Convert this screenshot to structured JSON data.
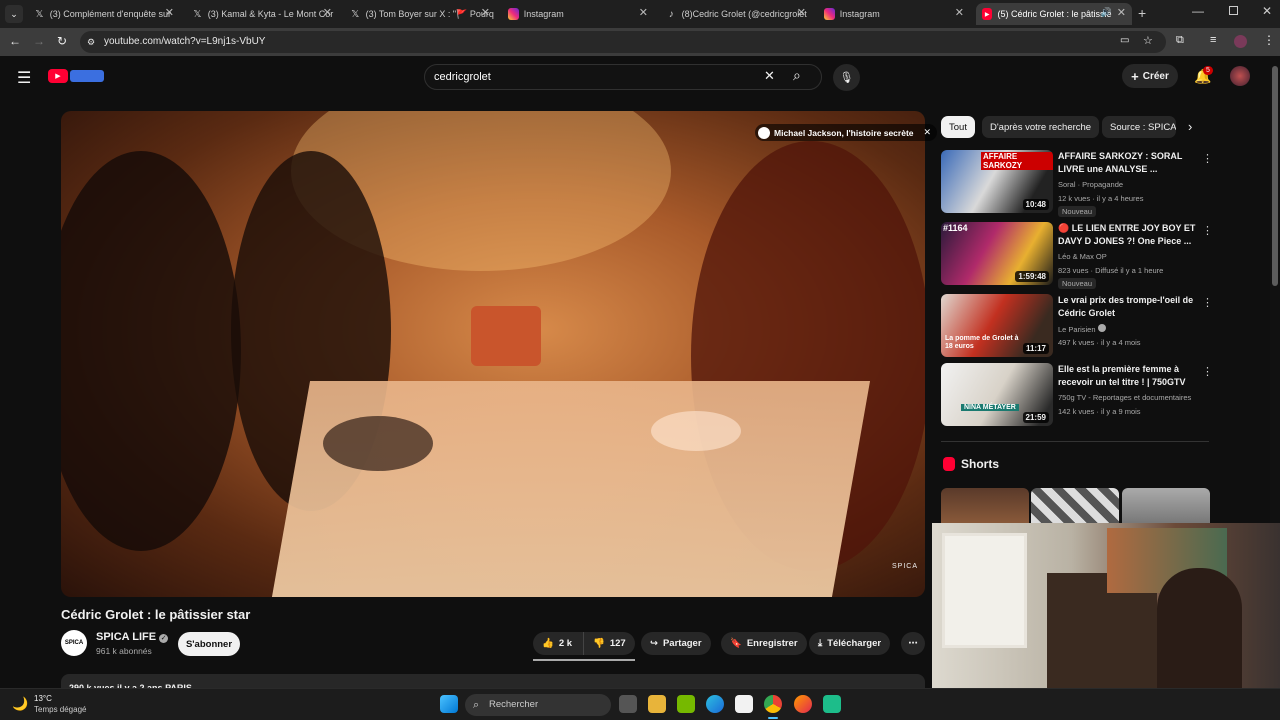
{
  "browser": {
    "tabs": [
      {
        "label": "(3) Complément d'enquête sur",
        "icon": "x-icon"
      },
      {
        "label": "(3) Kamal & Kyta - Le Mont Cor",
        "icon": "x-icon"
      },
      {
        "label": "(3) Tom Boyer sur X : \"🚩 Pourq",
        "icon": "x-icon"
      },
      {
        "label": "Instagram",
        "icon": "instagram-icon"
      },
      {
        "label": "(8)Cedric Grolet (@cedricgrolet",
        "icon": "tiktok-icon"
      },
      {
        "label": "Instagram",
        "icon": "instagram-icon"
      },
      {
        "label": "(5) Cédric Grolet : le pâtissie",
        "icon": "youtube-icon"
      }
    ],
    "url": "youtube.com/watch?v=L9nj1s-VbUY"
  },
  "header": {
    "search_value": "cedricgrolet",
    "create_label": "Créer",
    "notif_count": "5"
  },
  "video": {
    "card_text": "Michael Jackson, l'histoire secrète",
    "watermark": "SPICA",
    "title": "Cédric Grolet : le pâtissier star",
    "channel": "SPICA LIFE",
    "subscribers": "961 k abonnés",
    "subscribe_label": "S'abonner",
    "likes": "2 k",
    "dislikes": "127",
    "share_label": "Partager",
    "save_label": "Enregistrer",
    "download_label": "Télécharger",
    "desc_line": "290 k vues  il y a 2 ans  PARIS",
    "avatar_text": "SPICA"
  },
  "sidebar": {
    "chips": [
      "Tout",
      "D'après votre recherche",
      "Source : SPICA"
    ],
    "recs": [
      {
        "title": "AFFAIRE SARKOZY : SORAL LIVRE une ANALYSE ...",
        "channel": "Soral · Propagande",
        "meta": "12 k vues · il y a 4 heures",
        "badge": "Nouveau",
        "duration": "10:48",
        "thumb_text": "AFFAIRE SARKOZY"
      },
      {
        "title": "🔴 LE LIEN ENTRE JOY BOY ET DAVY D JONES ?! One Piece ...",
        "channel": "Léo & Max OP",
        "meta": "823 vues · Diffusé il y a 1 heure",
        "badge": "Nouveau",
        "duration": "1:59:48",
        "thumb_text": "#1164"
      },
      {
        "title": "Le vrai prix des trompe-l'oeil de Cédric Grolet",
        "channel": "Le Parisien",
        "meta": "497 k vues · il y a 4 mois",
        "badge": "",
        "duration": "11:17",
        "thumb_text": "La pomme de Grolet à 18 euros"
      },
      {
        "title": "Elle est la première femme à recevoir un tel titre ! | 750GTV",
        "channel": "750g TV - Reportages et documentaires",
        "meta": "142 k vues · il y a 9 mois",
        "badge": "",
        "duration": "21:59",
        "thumb_text": "NINA MÉTAYER"
      }
    ],
    "shorts_label": "Shorts"
  },
  "taskbar": {
    "temp": "13°C",
    "weather": "Temps dégagé",
    "search_placeholder": "Rechercher"
  },
  "colors": {
    "youtube_red": "#ff0033",
    "bg": "#0f0f0f"
  }
}
